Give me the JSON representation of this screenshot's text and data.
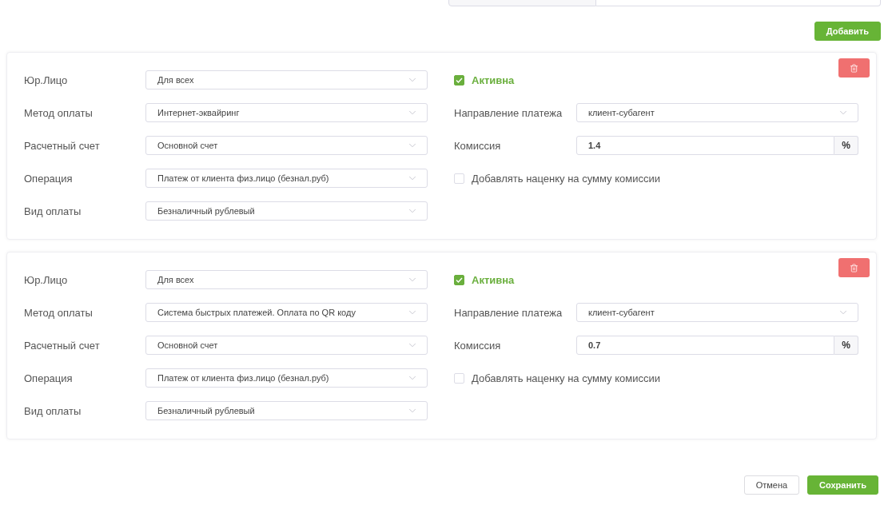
{
  "add_button": "Добавить",
  "rules": [
    {
      "fields": [
        {
          "label": "Юр.Лицо",
          "value": "Для всех"
        },
        {
          "label": "Метод оплаты",
          "value": "Интернет-эквайринг"
        },
        {
          "label": "Расчетный счет",
          "value": "Основной счет"
        },
        {
          "label": "Операция",
          "value": "Платеж от клиента физ.лицо (безнал.руб)"
        },
        {
          "label": "Вид оплаты",
          "value": "Безналичный рублевый"
        }
      ],
      "active": {
        "label": "Активна",
        "checked": true
      },
      "direction": {
        "label": "Направление платежа",
        "value": "клиент-субагент"
      },
      "commission": {
        "label": "Комиссия",
        "value": "1.4",
        "unit": "%"
      },
      "markup": {
        "label": "Добавлять наценку на сумму комиссии",
        "checked": false
      }
    },
    {
      "fields": [
        {
          "label": "Юр.Лицо",
          "value": "Для всех"
        },
        {
          "label": "Метод оплаты",
          "value": "Система быстрых платежей. Оплата по QR коду"
        },
        {
          "label": "Расчетный счет",
          "value": "Основной счет"
        },
        {
          "label": "Операция",
          "value": "Платеж от клиента физ.лицо (безнал.руб)"
        },
        {
          "label": "Вид оплаты",
          "value": "Безналичный рублевый"
        }
      ],
      "active": {
        "label": "Активна",
        "checked": true
      },
      "direction": {
        "label": "Направление платежа",
        "value": "клиент-субагент"
      },
      "commission": {
        "label": "Комиссия",
        "value": "0.7",
        "unit": "%"
      },
      "markup": {
        "label": "Добавлять наценку на сумму комиссии",
        "checked": false
      }
    }
  ],
  "footer": {
    "buttons": [
      {
        "label": "Отмена",
        "kind": "secondary"
      },
      {
        "label": "Сохранить",
        "kind": "primary"
      }
    ]
  }
}
